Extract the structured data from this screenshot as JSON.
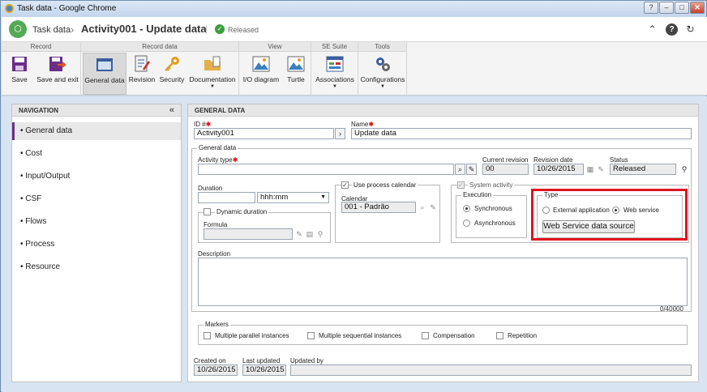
{
  "window": {
    "title": "Task data - Google Chrome",
    "controls": [
      "?",
      "–",
      "□",
      "✕"
    ]
  },
  "header": {
    "app_name": "Task data",
    "crumb_sep": "›",
    "record_title": "Activity001 - Update data",
    "separator": "|",
    "status": "Released"
  },
  "ribbon": {
    "groups": [
      "Record",
      "Record data",
      "View",
      "SE Suite",
      "Tools"
    ],
    "buttons": {
      "save": "Save",
      "save_exit": "Save and exit",
      "general_data": "General data",
      "revision": "Revision",
      "security": "Security",
      "documentation": "Documentation",
      "io_diagram": "I/O diagram",
      "turtle": "Turtle",
      "associations": "Associations",
      "configurations": "Configurations"
    },
    "dropdown_arrow": "▼"
  },
  "nav": {
    "title": "NAVIGATION",
    "collapse": "«",
    "items": [
      {
        "label": "General data"
      },
      {
        "label": "Cost"
      },
      {
        "label": "Input/Output"
      },
      {
        "label": "CSF"
      },
      {
        "label": "Flows"
      },
      {
        "label": "Process"
      },
      {
        "label": "Resource"
      }
    ]
  },
  "main": {
    "title": "GENERAL DATA",
    "id_label": "ID #",
    "id_value": "Activity001",
    "name_label": "Name",
    "name_value": "Update data",
    "required_mark": "✱",
    "general_data_legend": "General data",
    "activity_type_label": "Activity type",
    "activity_type_value": "",
    "current_revision_label": "Current revision",
    "current_revision_value": "00",
    "revision_date_label": "Revision date",
    "revision_date_value": "10/26/2015",
    "status_label": "Status",
    "status_value": "Released",
    "duration_label": "Duration",
    "duration_value": "",
    "duration_unit": "hhh:mm",
    "dynamic_duration_label": "Dynamic duration",
    "formula_label": "Formula",
    "formula_value": "",
    "use_process_calendar_label": "Use process calendar",
    "calendar_label": "Calendar",
    "calendar_value": "001 - Padrão",
    "system_activity_label": "System activity",
    "execution_label": "Execution",
    "synchronous_label": "Synchronous",
    "asynchronous_label": "Asynchronous",
    "type_label": "Type",
    "external_application_label": "External application",
    "web_service_label": "Web service",
    "ws_data_source_button": "Web Service data source",
    "description_label": "Description",
    "description_value": "",
    "description_counter": "0/40000",
    "markers_label": "Markers",
    "markers": [
      {
        "label": "Multiple parallel instances"
      },
      {
        "label": "Multiple sequential instances"
      },
      {
        "label": "Compensation"
      },
      {
        "label": "Repetition"
      }
    ],
    "created_on_label": "Created on",
    "created_on_value": "10/26/2015",
    "last_updated_label": "Last updated",
    "last_updated_value": "10/26/2015",
    "updated_by_label": "Updated by",
    "updated_by_value": ""
  },
  "colors": {
    "accent": "#6b2e86",
    "highlight": "#e1141d",
    "released": "#3a9e3f"
  }
}
